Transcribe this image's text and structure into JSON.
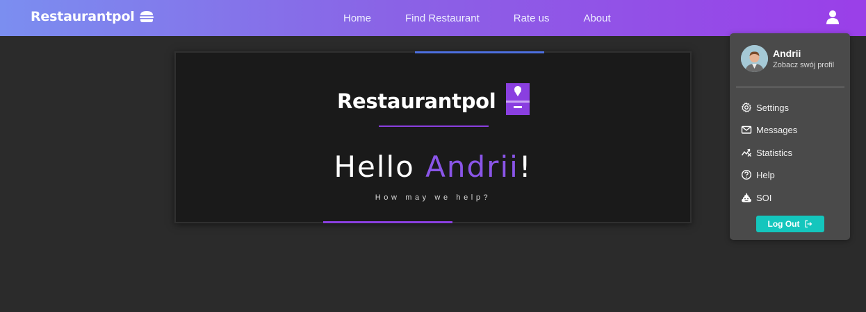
{
  "navbar": {
    "brand": "Restaurantpol",
    "brand_icon": "burger-icon",
    "links": [
      "Home",
      "Find Restaurant",
      "Rate us",
      "About"
    ],
    "user_icon": "user-icon"
  },
  "hero": {
    "brand": "Restaurantpol",
    "logo_icon": "ice-cream-logo-icon",
    "greeting_prefix": "Hello ",
    "user_name": "Andrii",
    "greeting_suffix": "!",
    "tagline": "How may we help?"
  },
  "dropdown": {
    "profile_name": "Andrii",
    "profile_link": "Zobacz swój profil",
    "items": [
      {
        "label": "Settings",
        "icon": "gear-icon"
      },
      {
        "label": "Messages",
        "icon": "envelope-icon"
      },
      {
        "label": "Statistics",
        "icon": "chart-icon"
      },
      {
        "label": "Help",
        "icon": "question-icon"
      },
      {
        "label": "SOI",
        "icon": "poop-icon"
      }
    ],
    "logout_label": "Log Out"
  },
  "colors": {
    "navbar_gradient": [
      "#7b8ef0",
      "#9a3fe8"
    ],
    "accent_purple": "#8a55e8",
    "accent_blue": "#4d6fe0",
    "logout_teal": "#14c6bd"
  }
}
